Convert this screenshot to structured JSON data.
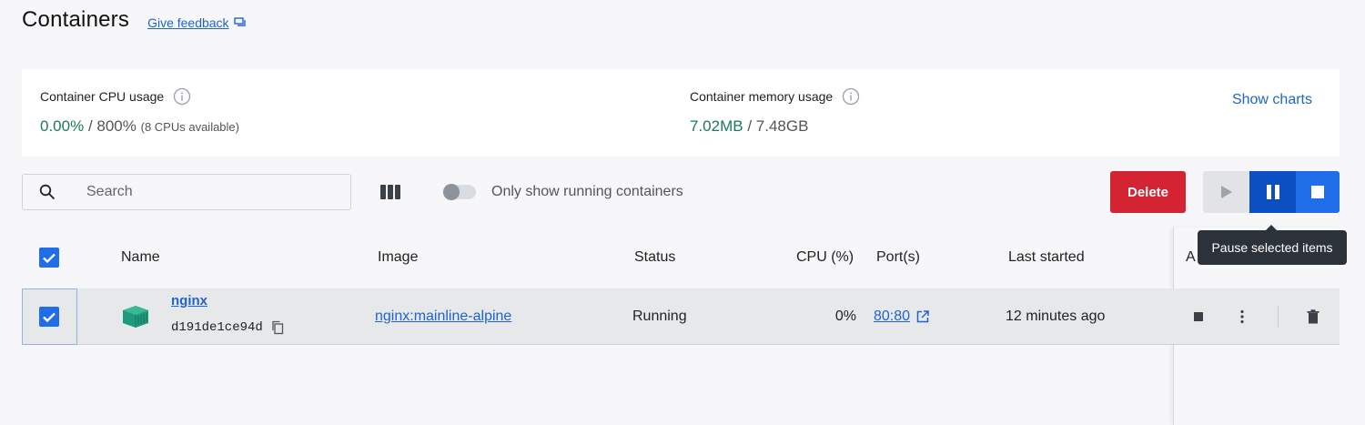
{
  "header": {
    "title": "Containers",
    "feedback_label": "Give feedback"
  },
  "stats": {
    "cpu": {
      "label": "Container CPU usage",
      "used": "0.00%",
      "total": "/ 800%",
      "note": "(8 CPUs available)"
    },
    "memory": {
      "label": "Container memory usage",
      "used": "7.02MB",
      "total": "/ 7.48GB"
    },
    "show_charts_label": "Show charts"
  },
  "toolbar": {
    "search_placeholder": "Search",
    "toggle_label": "Only show running containers",
    "toggle_on": false,
    "delete_label": "Delete"
  },
  "tooltip": {
    "text": "Pause selected items"
  },
  "table": {
    "columns": {
      "name": "Name",
      "image": "Image",
      "status": "Status",
      "cpu": "CPU (%)",
      "ports": "Port(s)",
      "last_started": "Last started",
      "actions": "A"
    },
    "rows": [
      {
        "selected": true,
        "name": "nginx",
        "id": "d191de1ce94d",
        "image": "nginx:mainline-alpine",
        "status": "Running",
        "cpu": "0%",
        "port": "80:80",
        "last_started": "12 minutes ago"
      }
    ]
  },
  "colors": {
    "accent_blue": "#1f6de8",
    "link_blue": "#1e63d6",
    "delete_red": "#d42434",
    "green": "#1d7a57",
    "pause_active": "#0b4fc2"
  },
  "icons": {
    "feedback": "feedback-icon",
    "info": "info-icon",
    "search": "search-icon",
    "columns": "columns-icon",
    "play": "play-icon",
    "pause": "pause-icon",
    "stop": "stop-icon",
    "container": "container-icon",
    "copy": "copy-icon",
    "external_link": "external-link-icon",
    "more": "more-vertical-icon",
    "trash": "trash-icon"
  }
}
